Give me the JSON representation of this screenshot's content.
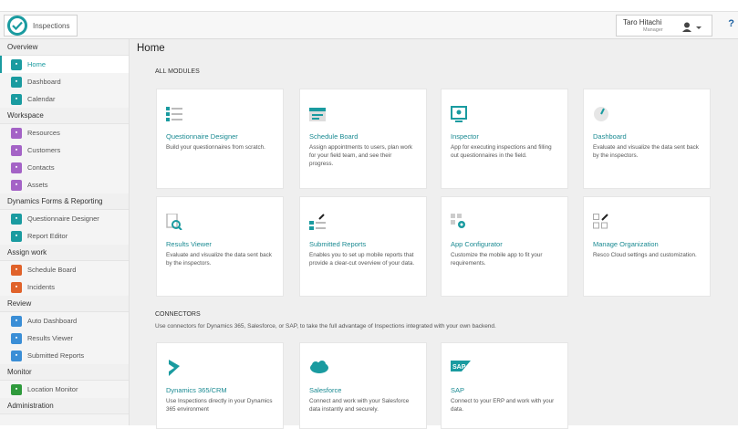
{
  "app": {
    "title": "Inspections"
  },
  "user": {
    "name": "Taro Hitachi",
    "role": "Manager",
    "help": "?"
  },
  "page": {
    "title": "Home"
  },
  "sidebar": {
    "sections": [
      {
        "label": "Overview",
        "items": [
          {
            "label": "Home",
            "icon": "home-icon",
            "color": "#1a9ba0",
            "active": true
          },
          {
            "label": "Dashboard",
            "icon": "dashboard-icon",
            "color": "#1a9ba0"
          },
          {
            "label": "Calendar",
            "icon": "calendar-icon",
            "color": "#1a9ba0"
          }
        ]
      },
      {
        "label": "Workspace",
        "items": [
          {
            "label": "Resources",
            "icon": "resources-icon",
            "color": "#a463c6"
          },
          {
            "label": "Customers",
            "icon": "customers-icon",
            "color": "#a463c6"
          },
          {
            "label": "Contacts",
            "icon": "contacts-icon",
            "color": "#a463c6"
          },
          {
            "label": "Assets",
            "icon": "assets-icon",
            "color": "#a463c6"
          }
        ]
      },
      {
        "label": "Dynamics Forms & Reporting",
        "items": [
          {
            "label": "Questionnaire Designer",
            "icon": "questionnaire-icon",
            "color": "#1a9ba0"
          },
          {
            "label": "Report Editor",
            "icon": "report-editor-icon",
            "color": "#1a9ba0"
          }
        ]
      },
      {
        "label": "Assign work",
        "items": [
          {
            "label": "Schedule Board",
            "icon": "schedule-icon",
            "color": "#e0622a"
          },
          {
            "label": "Incidents",
            "icon": "incidents-icon",
            "color": "#e0622a"
          }
        ]
      },
      {
        "label": "Review",
        "items": [
          {
            "label": "Auto Dashboard",
            "icon": "auto-dashboard-icon",
            "color": "#3a8ed6"
          },
          {
            "label": "Results Viewer",
            "icon": "results-icon",
            "color": "#3a8ed6"
          },
          {
            "label": "Submitted Reports",
            "icon": "submitted-icon",
            "color": "#3a8ed6"
          }
        ]
      },
      {
        "label": "Monitor",
        "items": [
          {
            "label": "Location Monitor",
            "icon": "location-icon",
            "color": "#2f9a3c"
          }
        ]
      },
      {
        "label": "Administration",
        "items": []
      }
    ]
  },
  "modules": {
    "title": "ALL MODULES",
    "cards": [
      {
        "title": "Questionnaire Designer",
        "desc": "Build your questionnaires from scratch.",
        "icon": "questionnaire-designer-icon"
      },
      {
        "title": "Schedule Board",
        "desc": "Assign appointments to users, plan work for your field team, and see their progress.",
        "icon": "schedule-board-icon"
      },
      {
        "title": "Inspector",
        "desc": "App for executing inspections and filling out questionnaires in the field.",
        "icon": "inspector-icon"
      },
      {
        "title": "Dashboard",
        "desc": "Evaluate and visualize the data sent back by the inspectors.",
        "icon": "dashboard-gauge-icon"
      },
      {
        "title": "Results Viewer",
        "desc": "Evaluate and visualize the data sent back by the inspectors.",
        "icon": "results-viewer-icon"
      },
      {
        "title": "Submitted Reports",
        "desc": "Enables you to set up mobile reports that provide a clear-cut overview of your data.",
        "icon": "submitted-reports-icon"
      },
      {
        "title": "App Configurator",
        "desc": "Customize the mobile app to fit your requirements.",
        "icon": "app-configurator-icon"
      },
      {
        "title": "Manage Organization",
        "desc": "Resco Cloud settings and customization.",
        "icon": "manage-organization-icon"
      }
    ]
  },
  "connectors": {
    "title": "CONNECTORS",
    "desc": "Use connectors for Dynamics 365, Salesforce, or SAP, to take the full advantage of Inspections integrated with your own backend.",
    "cards": [
      {
        "title": "Dynamics 365/CRM",
        "desc": "Use Inspections directly in your Dynamics 365 environment",
        "icon": "dynamics-icon"
      },
      {
        "title": "Salesforce",
        "desc": "Connect and work with your Salesforce data instantly and securely.",
        "icon": "salesforce-icon"
      },
      {
        "title": "SAP",
        "desc": "Connect to your ERP and work with your data.",
        "icon": "sap-icon",
        "logo_text": "SAP"
      }
    ]
  }
}
